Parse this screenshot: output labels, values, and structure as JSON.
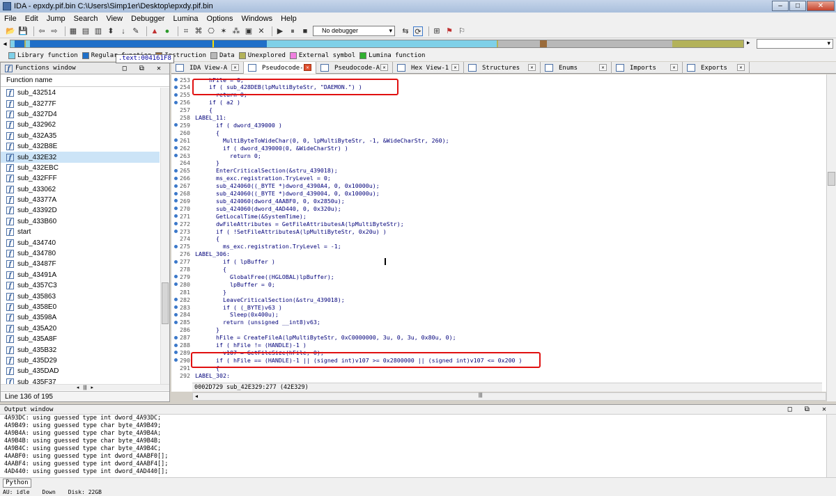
{
  "window": {
    "title": "IDA - epxdy.pif.bin C:\\Users\\Simp1er\\Desktop\\epxdy.pif.bin"
  },
  "menu": [
    "File",
    "Edit",
    "Jump",
    "Search",
    "View",
    "Debugger",
    "Lumina",
    "Options",
    "Windows",
    "Help"
  ],
  "toolbar": {
    "debugger_select": "No debugger"
  },
  "legend": [
    {
      "label": "Library function",
      "color": "#7fd0e8"
    },
    {
      "label": "Regular function",
      "color": "#1f6fc8"
    },
    {
      "label": "Instruction",
      "color": "#9a6b3b"
    },
    {
      "label": "Data",
      "color": "#b8b8b8"
    },
    {
      "label": "Unexplored",
      "color": "#b3b25a"
    },
    {
      "label": "External symbol",
      "color": "#f07fe0"
    },
    {
      "label": "Lumina function",
      "color": "#30b030"
    }
  ],
  "address_tooltip": ".text:004161F8",
  "functions_window": {
    "title": "Functions window",
    "column": "Function name",
    "items": [
      "sub_432514",
      "sub_43277F",
      "sub_4327D4",
      "sub_432962",
      "sub_432A35",
      "sub_432B8E",
      "sub_432E32",
      "sub_432EBC",
      "sub_432FFF",
      "sub_433062",
      "sub_43377A",
      "sub_43392D",
      "sub_433B60",
      "start",
      "sub_434740",
      "sub_434780",
      "sub_43487F",
      "sub_43491A",
      "sub_4357C3",
      "sub_435863",
      "sub_4358E0",
      "sub_43598A",
      "sub_435A20",
      "sub_435A8F",
      "sub_435B32",
      "sub_435D29",
      "sub_435DAD",
      "sub_435F37"
    ],
    "selected_index": 6,
    "status": "Line 136 of 195"
  },
  "tabs": [
    {
      "label": "IDA View-A",
      "active": false
    },
    {
      "label": "Pseudocode-B",
      "active": true
    },
    {
      "label": "Pseudocode-A",
      "active": false
    },
    {
      "label": "Hex View-1",
      "active": false
    },
    {
      "label": "Structures",
      "active": false
    },
    {
      "label": "Enums",
      "active": false
    },
    {
      "label": "Imports",
      "active": false
    },
    {
      "label": "Exports",
      "active": false
    }
  ],
  "code_lines": [
    {
      "n": "253",
      "dot": true,
      "text": "    hFile = 0;"
    },
    {
      "n": "254",
      "dot": true,
      "text": "    if ( sub_428DEB(lpMultiByteStr, \"DAEMON.\") )"
    },
    {
      "n": "255",
      "dot": true,
      "text": "      return 0;"
    },
    {
      "n": "256",
      "dot": true,
      "text": "    if ( a2 )"
    },
    {
      "n": "257",
      "dot": false,
      "text": "    {"
    },
    {
      "n": "258",
      "dot": false,
      "text": "LABEL_11:"
    },
    {
      "n": "259",
      "dot": true,
      "text": "      if ( dword_439000 )"
    },
    {
      "n": "260",
      "dot": false,
      "text": "      {"
    },
    {
      "n": "261",
      "dot": true,
      "text": "        MultiByteToWideChar(0, 0, lpMultiByteStr, -1, &WideCharStr, 260);"
    },
    {
      "n": "262",
      "dot": true,
      "text": "        if ( dword_439000(0, &WideCharStr) )"
    },
    {
      "n": "263",
      "dot": true,
      "text": "          return 0;"
    },
    {
      "n": "264",
      "dot": false,
      "text": "      }"
    },
    {
      "n": "265",
      "dot": true,
      "text": "      EnterCriticalSection(&stru_439018);"
    },
    {
      "n": "266",
      "dot": true,
      "text": "      ms_exc.registration.TryLevel = 0;"
    },
    {
      "n": "267",
      "dot": true,
      "text": "      sub_424060((_BYTE *)dword_4390A4, 0, 0x10000u);"
    },
    {
      "n": "268",
      "dot": true,
      "text": "      sub_424060((_BYTE *)dword_439004, 0, 0x10000u);"
    },
    {
      "n": "269",
      "dot": true,
      "text": "      sub_424060(dword_4AABF0, 0, 0x2850u);"
    },
    {
      "n": "270",
      "dot": true,
      "text": "      sub_424060(dword_4AD440, 0, 0x320u);"
    },
    {
      "n": "271",
      "dot": true,
      "text": "      GetLocalTime(&SystemTime);"
    },
    {
      "n": "272",
      "dot": true,
      "text": "      dwFileAttributes = GetFileAttributesA(lpMultiByteStr);"
    },
    {
      "n": "273",
      "dot": true,
      "text": "      if ( !SetFileAttributesA(lpMultiByteStr, 0x20u) )"
    },
    {
      "n": "274",
      "dot": false,
      "text": "      {"
    },
    {
      "n": "275",
      "dot": true,
      "text": "        ms_exc.registration.TryLevel = -1;"
    },
    {
      "n": "276",
      "dot": false,
      "text": "LABEL_306:"
    },
    {
      "n": "277",
      "dot": true,
      "text": "        if ( lpBuffer )"
    },
    {
      "n": "278",
      "dot": false,
      "text": "        {"
    },
    {
      "n": "279",
      "dot": true,
      "text": "          GlobalFree((HGLOBAL)lpBuffer);"
    },
    {
      "n": "280",
      "dot": true,
      "text": "          lpBuffer = 0;"
    },
    {
      "n": "281",
      "dot": false,
      "text": "        }"
    },
    {
      "n": "282",
      "dot": true,
      "text": "        LeaveCriticalSection(&stru_439018);"
    },
    {
      "n": "283",
      "dot": true,
      "text": "        if ( (_BYTE)v63 )"
    },
    {
      "n": "284",
      "dot": true,
      "text": "          Sleep(0x400u);"
    },
    {
      "n": "285",
      "dot": true,
      "text": "        return (unsigned __int8)v63;"
    },
    {
      "n": "286",
      "dot": false,
      "text": "      }"
    },
    {
      "n": "287",
      "dot": true,
      "text": "      hFile = CreateFileA(lpMultiByteStr, 0xC0000000, 3u, 0, 3u, 0x80u, 0);"
    },
    {
      "n": "288",
      "dot": true,
      "text": "      if ( hFile != (HANDLE)-1 )"
    },
    {
      "n": "289",
      "dot": true,
      "text": "        v107 = GetFileSize(hFile, 0);"
    },
    {
      "n": "290",
      "dot": true,
      "text": "      if ( hFile == (HANDLE)-1 || (signed int)v107 >= 0x2800000 || (signed int)v107 <= 0x200 )"
    },
    {
      "n": "291",
      "dot": false,
      "text": "      {"
    },
    {
      "n": "292",
      "dot": false,
      "text": "LABEL_302:"
    }
  ],
  "code_status": "0002D729 sub_42E329:277 (42E329)",
  "output_window": {
    "title": "Output window",
    "lines": [
      "4A93DC: using guessed type int dword_4A93DC;",
      "4A9B49: using guessed type char byte_4A9B49;",
      "4A9B4A: using guessed type char byte_4A9B4A;",
      "4A9B4B: using guessed type char byte_4A9B4B;",
      "4A9B4C: using guessed type char byte_4A9B4C;",
      "4AABF0: using guessed type int dword_4AABF0[];",
      "4AABF4: using guessed type int dword_4AABF4[];",
      "4AD440: using guessed type int dword_4AD440[];"
    ]
  },
  "python_label": "Python",
  "statusbar": {
    "au": "AU:  idle",
    "dir": "Down",
    "disk": "Disk: 22GB"
  }
}
